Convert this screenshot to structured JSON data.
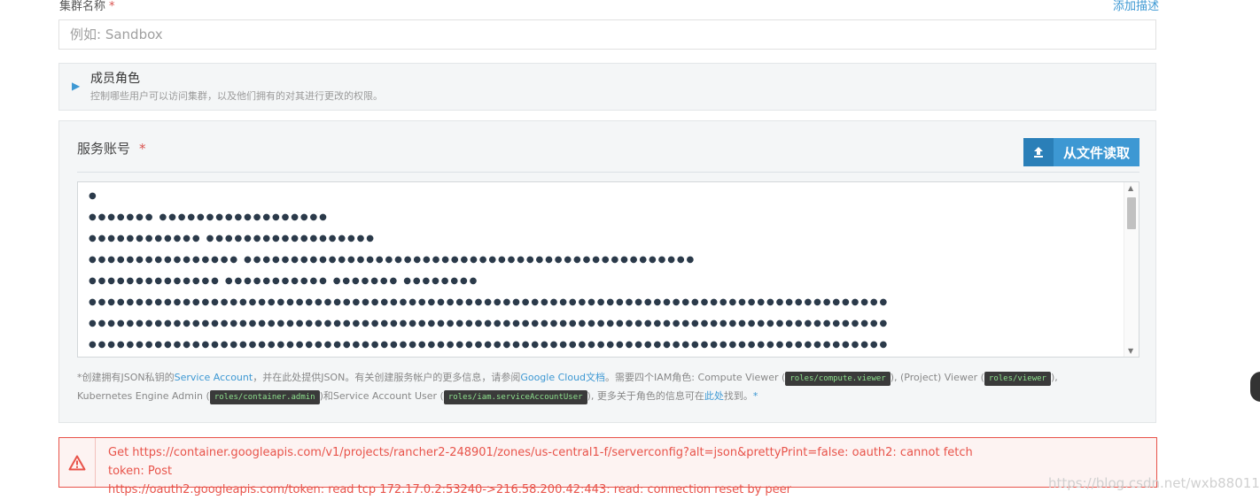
{
  "cluster_name": {
    "label": "集群名称",
    "required_mark": "*",
    "add_description_link": "添加描述",
    "placeholder": "例如: Sandbox"
  },
  "member_roles": {
    "title": "成员角色",
    "subtitle": "控制哪些用户可以访问集群，以及他们拥有的对其进行更改的权限。",
    "expand_icon": "triangle-right-icon"
  },
  "service_account": {
    "title": "服务账号",
    "required_mark": "*",
    "read_file_button": "从文件读取",
    "upload_icon": "upload-icon",
    "masked_lines": [
      "●",
      "   ●●●●●●● ●●●●●●●●●●●●●●●●●●",
      "   ●●●●●●●●●●●● ●●●●●●●●●●●●●●●●●●",
      "   ●●●●●●●●●●●●●●●● ●●●●●●●●●●●●●●●●●●●●●●●●●●●●●●●●●●●●●●●●●●●●●●●●",
      "   ●●●●●●●●●●●●●● ●●●●●●●●●●● ●●●●●●● ●●●●●●●●",
      "●●●●●●●●●●●●●●●●●●●●●●●●●●●●●●●●●●●●●●●●●●●●●●●●●●●●●●●●●●●●●●●●●●●●●●●●●●●●●●●●●●●●●",
      "●●●●●●●●●●●●●●●●●●●●●●●●●●●●●●●●●●●●●●●●●●●●●●●●●●●●●●●●●●●●●●●●●●●●●●●●●●●●●●●●●●●●●",
      "●●●●●●●●●●●●●●●●●●●●●●●●●●●●●●●●●●●●●●●●●●●●●●●●●●●●●●●●●●●●●●●●●●●●●●●●●●●●●●●●●●●●●"
    ],
    "help": {
      "p1": "*创建拥有JSON私钥的",
      "link_sa": "Service Account",
      "p2": "，并在此处提供JSON。有关创建服务帐户的更多信息，请参阅",
      "link_docs": "Google Cloud文档",
      "p3": "。需要四个IAM角色: Compute Viewer (",
      "code_compute": "roles/compute.viewer",
      "p4": "), (Project) Viewer (",
      "code_viewer": "roles/viewer",
      "p5": "), Kubernetes Engine Admin (",
      "code_container": "roles/container.admin",
      "p6": ")和Service Account User (",
      "code_iam": "roles/iam.serviceAccountUser",
      "p7": "), 更多关于角色的信息可在",
      "link_here": "此处",
      "p8": "找到。",
      "p9": "*"
    }
  },
  "error": {
    "icon": "warning-triangle-icon",
    "line1": "Get https://container.googleapis.com/v1/projects/rancher2-248901/zones/us-central1-f/serverconfig?alt=json&prettyPrint=false: oauth2: cannot fetch token: Post",
    "line2": "https://oauth2.googleapis.com/token: read tcp 172.17.0.2:53240->216.58.200.42:443: read: connection reset by peer"
  },
  "watermark": "https://blog.csdn.net/wxb880114",
  "colors": {
    "accent": "#3d98d3",
    "error": "#e8534a",
    "panel_bg": "#f4f6f7"
  }
}
